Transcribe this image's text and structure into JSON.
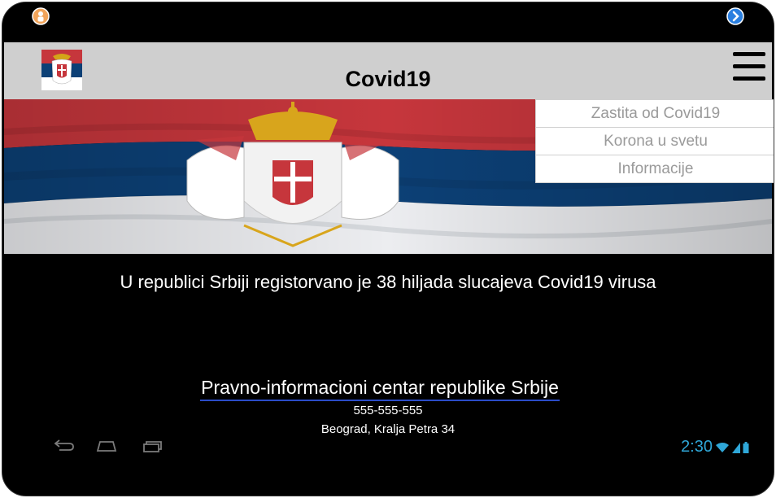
{
  "app": {
    "title": "Covid19"
  },
  "menu": {
    "items": [
      {
        "label": "Zastita od Covid19"
      },
      {
        "label": "Korona u svetu"
      },
      {
        "label": "Informacije"
      }
    ]
  },
  "main": {
    "headline": "U republici Srbiji registorvano je 38 hiljada slucajeva Covid19 virusa",
    "center_link": "Pravno-informacioni centar republike Srbije",
    "phone": "555-555-555",
    "address": "Beograd, Kralja Petra 34"
  },
  "statusbar": {
    "time": "2:30"
  },
  "colors": {
    "flag_red": "#c6363c",
    "flag_blue": "#0c4076",
    "flag_white": "#ffffff",
    "accent": "#2fa7d8",
    "link_underline": "#2a4cc8"
  },
  "icons": {
    "top_left": "user-badge-icon",
    "top_right": "forward-arrow-icon",
    "menu": "hamburger-icon",
    "nav": [
      "back-icon",
      "home-icon",
      "recent-apps-icon"
    ],
    "status": [
      "wifi-icon",
      "signal-icon",
      "battery-icon"
    ]
  }
}
